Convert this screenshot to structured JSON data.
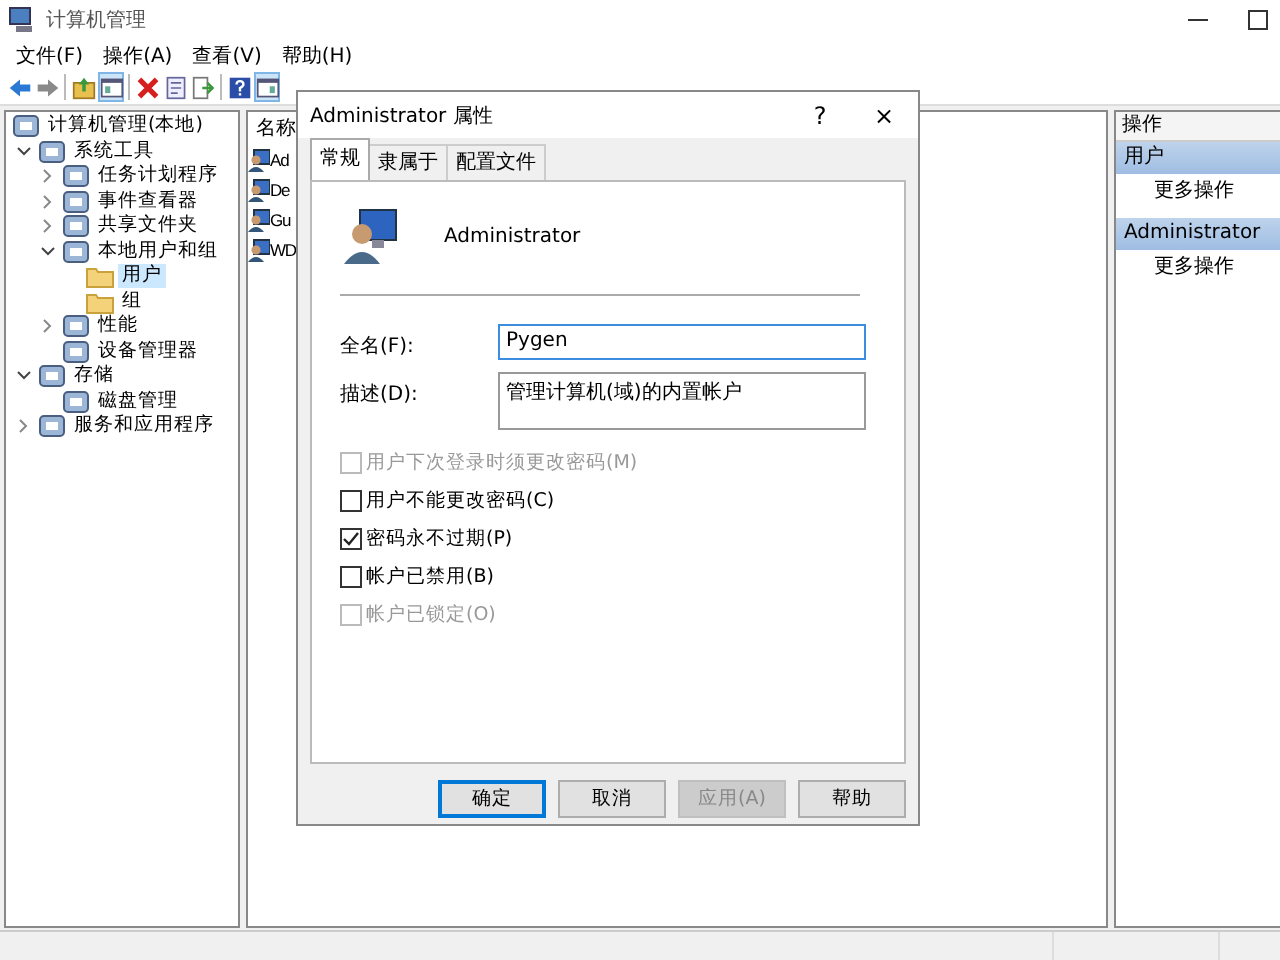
{
  "window": {
    "title": "计算机管理"
  },
  "menu": [
    {
      "label": "文件(F)"
    },
    {
      "label": "操作(A)"
    },
    {
      "label": "查看(V)"
    },
    {
      "label": "帮助(H)"
    }
  ],
  "toolbar": [
    {
      "kind": "back",
      "pressed": false
    },
    {
      "kind": "forward",
      "pressed": false
    },
    {
      "kind": "separator"
    },
    {
      "kind": "up",
      "pressed": false
    },
    {
      "kind": "tree",
      "pressed": true
    },
    {
      "kind": "separator"
    },
    {
      "kind": "delete",
      "pressed": false
    },
    {
      "kind": "properties",
      "pressed": false
    },
    {
      "kind": "export",
      "pressed": false
    },
    {
      "kind": "separator"
    },
    {
      "kind": "help",
      "pressed": false
    },
    {
      "kind": "pane",
      "pressed": true
    }
  ],
  "tree": [
    {
      "label": "计算机管理(本地)",
      "selected": false,
      "children": [
        {
          "label": "系统工具",
          "expanded": true,
          "selected": false,
          "children": [
            {
              "label": "任务计划程序",
              "expanded": false,
              "selected": false
            },
            {
              "label": "事件查看器",
              "expanded": false,
              "selected": false
            },
            {
              "label": "共享文件夹",
              "expanded": false,
              "selected": false
            },
            {
              "label": "本地用户和组",
              "expanded": true,
              "selected": false,
              "children": [
                {
                  "label": "用户",
                  "selected": true
                },
                {
                  "label": "组",
                  "selected": false
                }
              ]
            },
            {
              "label": "性能",
              "expanded": false,
              "selected": false
            },
            {
              "label": "设备管理器",
              "selected": false
            }
          ]
        },
        {
          "label": "存储",
          "expanded": true,
          "selected": false,
          "children": [
            {
              "label": "磁盘管理",
              "selected": false
            }
          ]
        },
        {
          "label": "服务和应用程序",
          "expanded": false,
          "selected": false
        }
      ]
    }
  ],
  "list": {
    "columns": [
      "名称"
    ],
    "rows": [
      {
        "name": "Ad"
      },
      {
        "name": "De"
      },
      {
        "name": "Gu"
      },
      {
        "name": "WD"
      }
    ]
  },
  "actions": {
    "title": "操作",
    "sections": [
      {
        "title": "用户",
        "items": [
          "更多操作"
        ]
      },
      {
        "title": "Administrator",
        "items": [
          "更多操作"
        ]
      }
    ]
  },
  "dialog": {
    "title": "Administrator 属性",
    "help": "?",
    "close": "×",
    "tabs": [
      {
        "label": "常规",
        "selected": true
      },
      {
        "label": "隶属于",
        "selected": false
      },
      {
        "label": "配置文件",
        "selected": false
      }
    ],
    "user_name": "Administrator",
    "fields": [
      {
        "label": "全名(F):",
        "value": "Pygen",
        "focused": true,
        "multiline": false
      },
      {
        "label": "描述(D):",
        "value": "管理计算机(域)的内置帐户",
        "focused": false,
        "multiline": true
      }
    ],
    "checkboxes": [
      {
        "label": "用户下次登录时须更改密码(M)",
        "checked": false,
        "disabled": true
      },
      {
        "label": "用户不能更改密码(C)",
        "checked": false,
        "disabled": false
      },
      {
        "label": "密码永不过期(P)",
        "checked": true,
        "disabled": false
      },
      {
        "label": "帐户已禁用(B)",
        "checked": false,
        "disabled": false
      },
      {
        "label": "帐户已锁定(O)",
        "checked": false,
        "disabled": true
      }
    ],
    "buttons": [
      {
        "label": "确定",
        "default": true,
        "disabled": false
      },
      {
        "label": "取消",
        "default": false,
        "disabled": false
      },
      {
        "label": "应用(A)",
        "default": false,
        "disabled": true
      },
      {
        "label": "帮助",
        "default": false,
        "disabled": false
      }
    ]
  }
}
